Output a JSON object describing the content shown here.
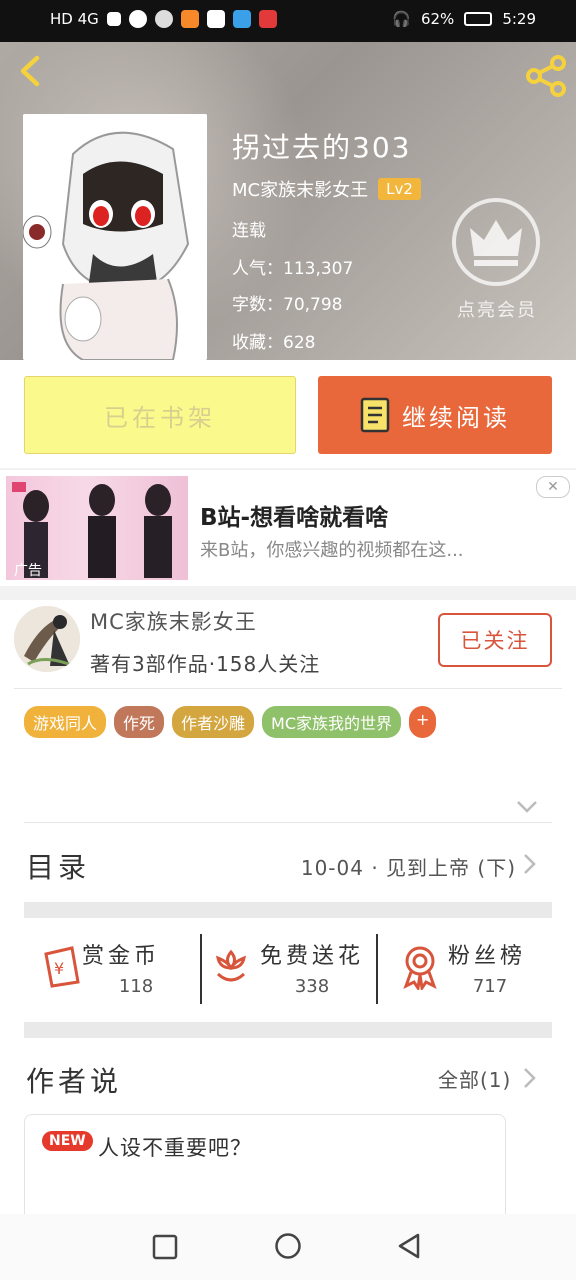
{
  "status_bar": {
    "left_label": "HD 4G",
    "battery": "62%",
    "time": "5:29"
  },
  "book": {
    "title": "拐过去的303",
    "author": "MC家族末影女王",
    "level": "Lv2",
    "status": "连载",
    "popularity_label": "人气：113,307",
    "words_label": "字数：70,798",
    "favorites_label": "收藏：628"
  },
  "vip": {
    "label": "点亮会员"
  },
  "actions": {
    "shelf_label": "已在书架",
    "read_label": "继续阅读"
  },
  "ad": {
    "title": "B站-想看啥就看啥",
    "description": "来B站，你感兴趣的视频都在这...",
    "tag": "广告",
    "close": "✕"
  },
  "author_card": {
    "name": "MC家族末影女王",
    "stats": "著有3部作品·158人关注",
    "follow_label": "已关注"
  },
  "tags": [
    {
      "label": "游戏同人",
      "color": "#f0b23a"
    },
    {
      "label": "作死",
      "color": "#c0775a"
    },
    {
      "label": "作者沙雕",
      "color": "#d3a640"
    },
    {
      "label": "MC家族我的世界",
      "color": "#8fc06a"
    },
    {
      "label": "+",
      "color": "#e8683c"
    }
  ],
  "toc": {
    "label": "目录",
    "latest": "10-04 · 见到上帝 (下)"
  },
  "stats": [
    {
      "label": "赏金币",
      "value": "118",
      "icon": "coin-envelope-icon"
    },
    {
      "label": "免费送花",
      "value": "338",
      "icon": "flower-icon"
    },
    {
      "label": "粉丝榜",
      "value": "717",
      "icon": "ribbon-icon"
    }
  ],
  "author_says": {
    "label": "作者说",
    "all_label": "全部(1)",
    "badge": "NEW",
    "message": "人设不重要吧？"
  },
  "colors": {
    "accent": "#e8683c",
    "shelf_button": "#fafa8c",
    "lv_badge": "#f1b63b",
    "icon_red": "#d8553c"
  }
}
